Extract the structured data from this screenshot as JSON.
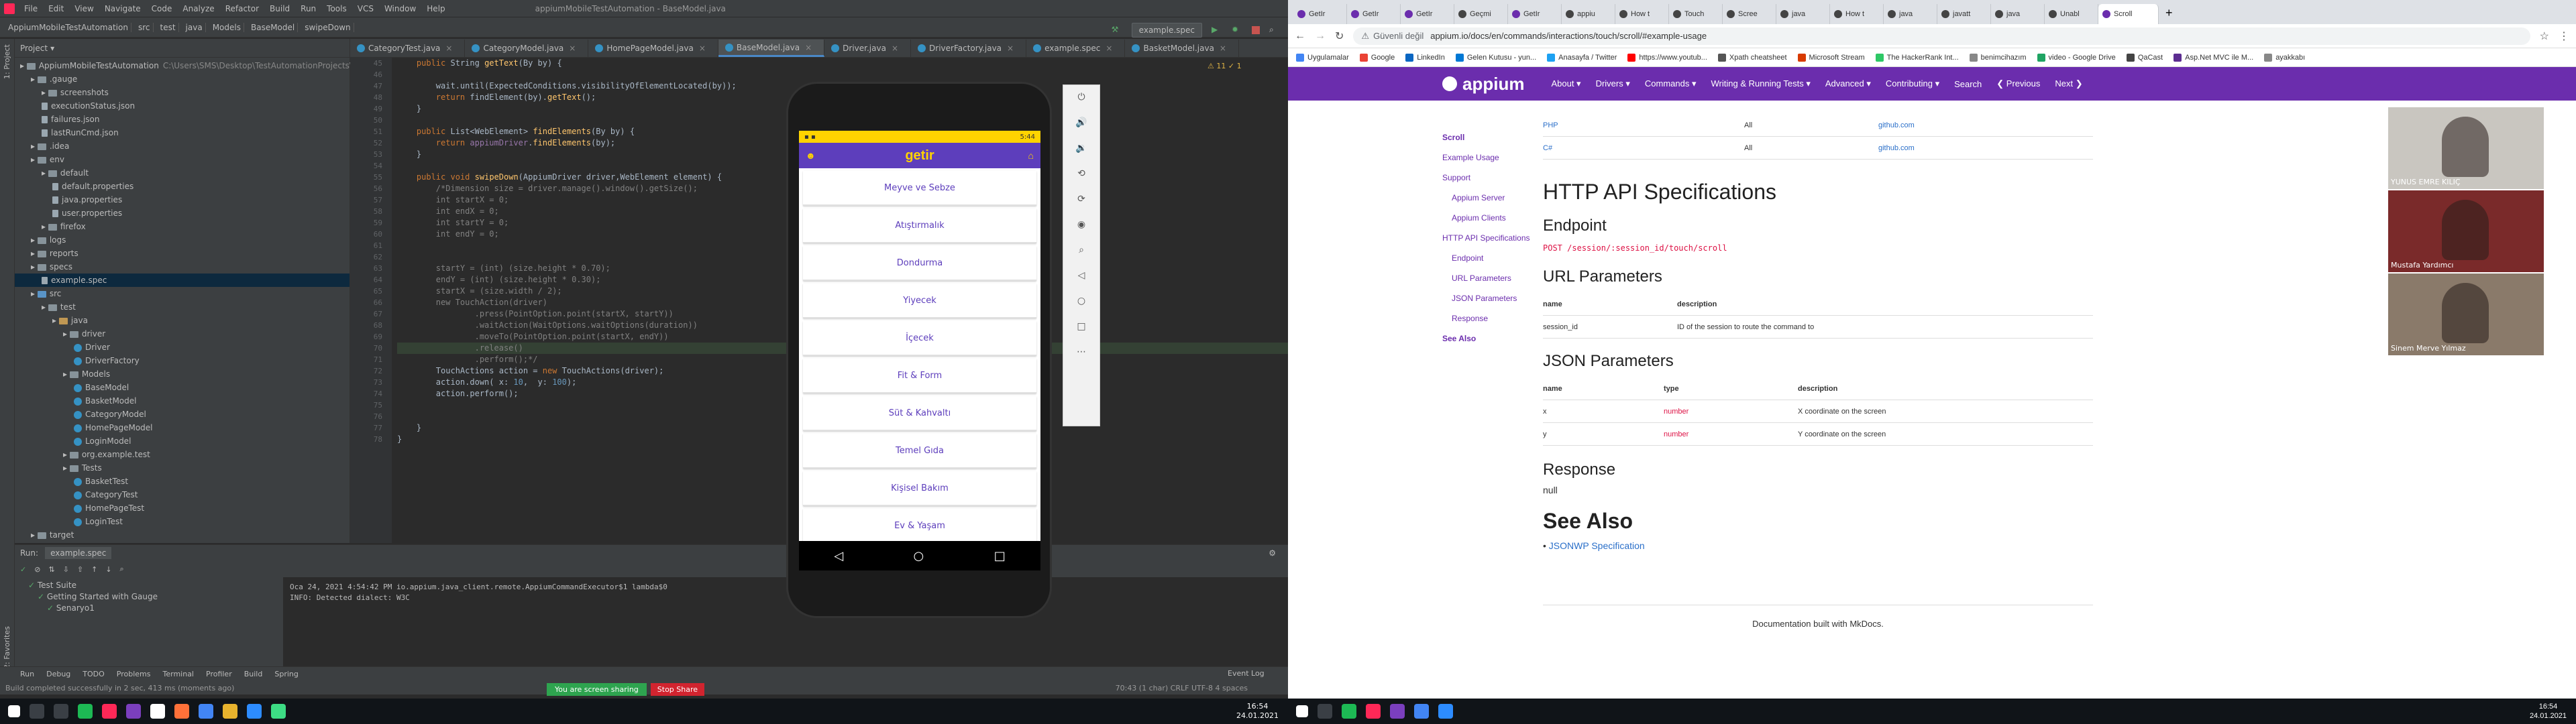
{
  "ide": {
    "menu": [
      "File",
      "Edit",
      "View",
      "Navigate",
      "Code",
      "Analyze",
      "Refactor",
      "Build",
      "Run",
      "Tools",
      "VCS",
      "Window",
      "Help"
    ],
    "window_title": "appiumMobileTestAutomation - BaseModel.java",
    "breadcrumbs": [
      "AppiumMobileTestAutomation",
      "src",
      "test",
      "java",
      "Models",
      "BaseModel",
      "swipeDown"
    ],
    "run_config": "example.spec",
    "project_label": "Project",
    "tree": [
      {
        "indent": 0,
        "label": "AppiumMobileTestAutomation",
        "extra": "C:\\Users\\SMS\\Desktop\\TestAutomationProjects\\app",
        "type": "folder"
      },
      {
        "indent": 1,
        "label": ".gauge",
        "type": "folder"
      },
      {
        "indent": 2,
        "label": "screenshots",
        "type": "folder"
      },
      {
        "indent": 2,
        "label": "executionStatus.json",
        "type": "file"
      },
      {
        "indent": 2,
        "label": "failures.json",
        "type": "file"
      },
      {
        "indent": 2,
        "label": "lastRunCmd.json",
        "type": "file"
      },
      {
        "indent": 1,
        "label": ".idea",
        "type": "folder"
      },
      {
        "indent": 1,
        "label": "env",
        "type": "folder"
      },
      {
        "indent": 2,
        "label": "default",
        "type": "folder"
      },
      {
        "indent": 3,
        "label": "default.properties",
        "type": "file"
      },
      {
        "indent": 3,
        "label": "java.properties",
        "type": "file"
      },
      {
        "indent": 3,
        "label": "user.properties",
        "type": "file"
      },
      {
        "indent": 2,
        "label": "firefox",
        "type": "folder"
      },
      {
        "indent": 1,
        "label": "logs",
        "type": "folder"
      },
      {
        "indent": 1,
        "label": "reports",
        "type": "folder"
      },
      {
        "indent": 1,
        "label": "specs",
        "type": "folder"
      },
      {
        "indent": 2,
        "label": "example.spec",
        "type": "file",
        "selected": true
      },
      {
        "indent": 1,
        "label": "src",
        "type": "src"
      },
      {
        "indent": 2,
        "label": "test",
        "type": "folder"
      },
      {
        "indent": 3,
        "label": "java",
        "type": "java"
      },
      {
        "indent": 4,
        "label": "driver",
        "type": "folder"
      },
      {
        "indent": 5,
        "label": "Driver",
        "type": "class"
      },
      {
        "indent": 5,
        "label": "DriverFactory",
        "type": "class"
      },
      {
        "indent": 4,
        "label": "Models",
        "type": "folder"
      },
      {
        "indent": 5,
        "label": "BaseModel",
        "type": "class"
      },
      {
        "indent": 5,
        "label": "BasketModel",
        "type": "class"
      },
      {
        "indent": 5,
        "label": "CategoryModel",
        "type": "class"
      },
      {
        "indent": 5,
        "label": "HomePageModel",
        "type": "class"
      },
      {
        "indent": 5,
        "label": "LoginModel",
        "type": "class"
      },
      {
        "indent": 4,
        "label": "org.example.test",
        "type": "folder"
      },
      {
        "indent": 4,
        "label": "Tests",
        "type": "folder"
      },
      {
        "indent": 5,
        "label": "BasketTest",
        "type": "class"
      },
      {
        "indent": 5,
        "label": "CategoryTest",
        "type": "class"
      },
      {
        "indent": 5,
        "label": "HomePageTest",
        "type": "class"
      },
      {
        "indent": 5,
        "label": "LoginTest",
        "type": "class"
      },
      {
        "indent": 1,
        "label": "target",
        "type": "folder"
      }
    ],
    "tabs": [
      "CategoryTest.java",
      "CategoryModel.java",
      "HomePageModel.java",
      "BaseModel.java",
      "Driver.java",
      "DriverFactory.java",
      "example.spec",
      "BasketModel.java"
    ],
    "active_tab": 3,
    "line_start": 45,
    "code": [
      "    public String getText(By by) {",
      "",
      "        wait.until(ExpectedConditions.visibilityOfElementLocated(by));",
      "        return findElement(by).getText();",
      "    }",
      "",
      "    public List<WebElement> findElements(By by) {",
      "        return appiumDriver.findElements(by);",
      "    }",
      "",
      "    public void swipeDown(AppiumDriver driver,WebElement element) {",
      "        /*Dimension size = driver.manage().window().getSize();",
      "        int startX = 0;",
      "        int endX = 0;",
      "        int startY = 0;",
      "        int endY = 0;",
      "",
      "",
      "        startY = (int) (size.height * 0.70);",
      "        endY = (int) (size.height * 0.30);",
      "        startX = (size.width / 2);",
      "        new TouchAction(driver)",
      "                .press(PointOption.point(startX, startY))",
      "                .waitAction(WaitOptions.waitOptions(duration))",
      "                .moveTo(PointOption.point(startX, endY))",
      "                .release()",
      "                .perform();*/",
      "        TouchActions action = new TouchActions(driver);",
      "        action.down( x: 10,  y: 100);",
      "        action.perform();",
      "",
      "",
      "    }",
      "}"
    ],
    "warnings": "⚠ 11  ✓ 1",
    "run_tab_label": "Run:",
    "run_tab_name": "example.spec",
    "run_tree": [
      "Test Suite",
      "Getting Started with Gauge",
      "Senaryo1"
    ],
    "console": [
      "Oca 24, 2021 4:54:42 PM io.appium.java_client.remote.AppiumCommandExecutor$1 lambda$0",
      "INFO: Detected dialect: W3C"
    ],
    "tool_tabs": [
      "Run",
      "Debug",
      "TODO",
      "Problems",
      "Terminal",
      "Profiler",
      "Build",
      "Spring"
    ],
    "event_log": "Event Log",
    "status": "Build completed successfully in 2 sec, 413 ms (moments ago)",
    "cursor_pos": "70:43 (1 char)  CRLF  UTF-8  4 spaces"
  },
  "share": {
    "message": "You are screen sharing",
    "stop": "Stop Share"
  },
  "emulator": {
    "status_time": "5:44",
    "app_title": "getir",
    "categories": [
      "Meyve ve Sebze",
      "Atıştırmalık",
      "Dondurma",
      "Yiyecek",
      "İçecek",
      "Fit & Form",
      "Süt & Kahvaltı",
      "Temel Gıda",
      "Kişisel Bakım",
      "Ev & Yaşam"
    ],
    "toolbar_icons": [
      "power-icon",
      "volume-up-icon",
      "volume-down-icon",
      "rotate-left-icon",
      "rotate-right-icon",
      "camera-icon",
      "zoom-icon",
      "back-icon",
      "home-icon",
      "overview-icon",
      "more-icon"
    ]
  },
  "taskbar_left": {
    "time": "16:54",
    "date": "24.01.2021"
  },
  "taskbar_right": {
    "time": "16:54",
    "date": "24.01.2021"
  },
  "browser": {
    "tabs": [
      "GetIr",
      "GetIr",
      "GetIr",
      "Geçmi",
      "GetIr",
      "appiu",
      "How t",
      "Touch",
      "Scree",
      "java",
      "How t",
      "java",
      "javatt",
      "java",
      "Unabl",
      "Scroll"
    ],
    "active_tab": 15,
    "security": "Güvenli değil",
    "url": "appium.io/docs/en/commands/interactions/touch/scroll/#example-usage",
    "bookmarks": [
      "Uygulamalar",
      "Google",
      "LinkedIn",
      "Gelen Kutusu - yun...",
      "Anasayfa / Twitter",
      "https://www.youtub...",
      "Xpath cheatsheet",
      "Microsoft Stream",
      "The HackerRank Int...",
      "benimcihazım",
      "video - Google Drive",
      "QaCast",
      "Asp.Net MVC ile M...",
      "ayakkabı"
    ],
    "site_name": "appium",
    "nav": [
      "About ▾",
      "Drivers ▾",
      "Commands ▾",
      "Writing & Running Tests ▾",
      "Advanced ▾",
      "Contributing ▾",
      "Search",
      "❮ Previous",
      "Next ❯"
    ],
    "sidenav": [
      "Scroll",
      "Example Usage",
      "Support",
      "Appium Server",
      "Appium Clients",
      "HTTP API Specifications",
      "Endpoint",
      "URL Parameters",
      "JSON Parameters",
      "Response",
      "See Also"
    ],
    "support_rows": [
      [
        "PHP",
        "All",
        "github.com"
      ],
      [
        "C#",
        "All",
        "github.com"
      ]
    ],
    "h_http": "HTTP API Specifications",
    "h_endpoint": "Endpoint",
    "endpoint_method": "POST",
    "endpoint_path": "/session/:session_id/touch/scroll",
    "h_url": "URL Parameters",
    "url_headers": [
      "name",
      "description"
    ],
    "url_rows": [
      [
        "session_id",
        "ID of the session to route the command to"
      ]
    ],
    "h_json": "JSON Parameters",
    "json_headers": [
      "name",
      "type",
      "description"
    ],
    "json_rows": [
      [
        "x",
        "number",
        "X coordinate on the screen"
      ],
      [
        "y",
        "number",
        "Y coordinate on the screen"
      ]
    ],
    "h_response": "Response",
    "response_value": "null",
    "h_see": "See Also",
    "see_link": "JSONWP Specification",
    "footer": "Documentation built with MkDocs."
  },
  "participants": [
    "YUNUS EMRE KILIÇ",
    "Mustafa Yardımcı",
    "Sinem Merve Yılmaz"
  ]
}
